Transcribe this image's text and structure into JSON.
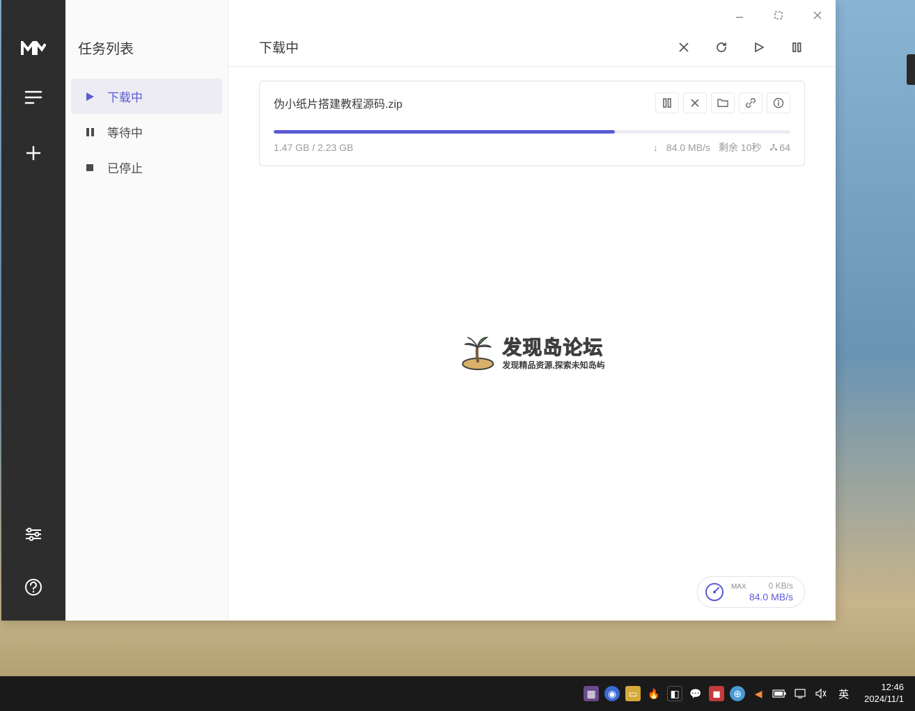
{
  "nav": {
    "title": "任务列表",
    "items": [
      {
        "label": "下载中",
        "icon": "play"
      },
      {
        "label": "等待中",
        "icon": "pause"
      },
      {
        "label": "已停止",
        "icon": "stop"
      }
    ]
  },
  "header": {
    "title": "下载中"
  },
  "task": {
    "filename": "伪小纸片搭建教程源码.zip",
    "downloaded": "1.47 GB",
    "total": "2.23 GB",
    "size_text": "1.47 GB / 2.23 GB",
    "speed": "84.0 MB/s",
    "remaining": "剩余 10秒",
    "connections": "64",
    "progress_percent": 66
  },
  "speedWidget": {
    "label": "MAX",
    "upload": "0 KB/s",
    "download": "84.0 MB/s"
  },
  "watermark": {
    "main": "发现岛论坛",
    "sub": "发现精品资源,探索未知岛屿"
  },
  "taskbar": {
    "ime": "英",
    "time": "12:46",
    "date": "2024/11/1"
  }
}
